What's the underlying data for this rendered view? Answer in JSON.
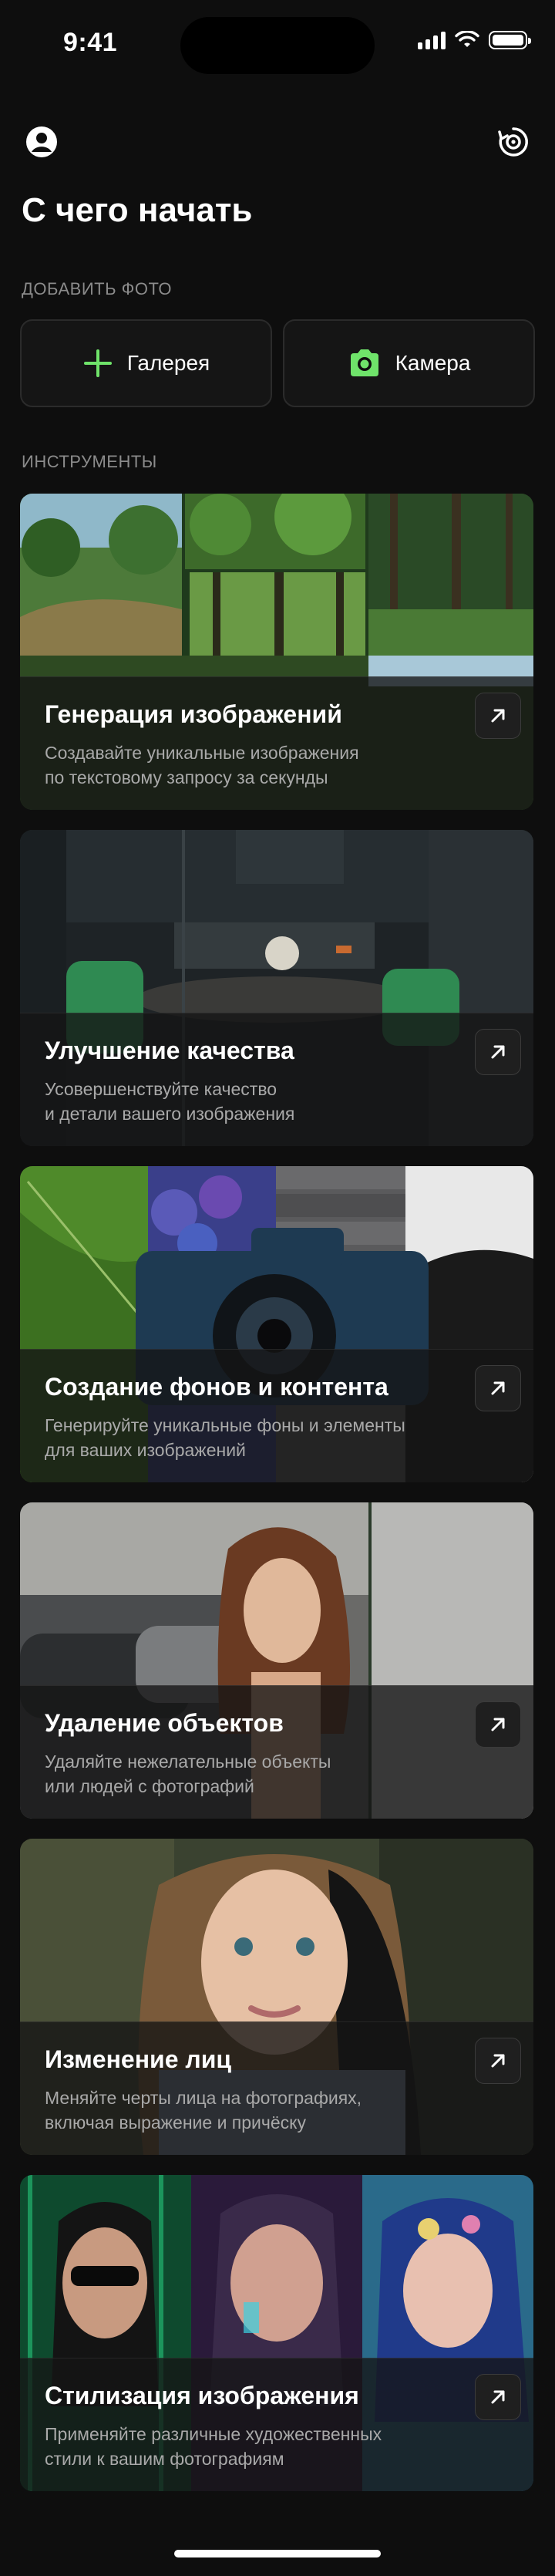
{
  "status_bar": {
    "time": "9:41"
  },
  "header": {
    "profile_icon": "user-circle-icon",
    "history_icon": "history-icon",
    "title": "С чего начать"
  },
  "add_photo": {
    "section_label": "ДОБАВИТЬ ФОТО",
    "gallery_label": "Галерея",
    "camera_label": "Камера",
    "accent_color": "#6fe36a"
  },
  "tools": {
    "section_label": "ИНСТРУМЕНТЫ",
    "cards": [
      {
        "title": "Генерация изображений",
        "description": "Создавайте уникальные изображения\nпо текстовому запросу за секунды"
      },
      {
        "title": "Улучшение качества",
        "description": "Усовершенствуйте качество\nи детали вашего изображения"
      },
      {
        "title": "Создание фонов и контента",
        "description": "Генерируйте уникальные фоны и элементы\nдля ваших изображений"
      },
      {
        "title": "Удаление объектов",
        "description": "Удаляйте нежелательные объекты\nили людей с фотографий"
      },
      {
        "title": "Изменение лиц",
        "description": "Меняйте черты лица на фотографиях,\nвключая выражение и причёску"
      },
      {
        "title": "Стилизация изображения",
        "description": "Применяйте различные художественных\nстили к вашим фотографиям"
      }
    ]
  }
}
